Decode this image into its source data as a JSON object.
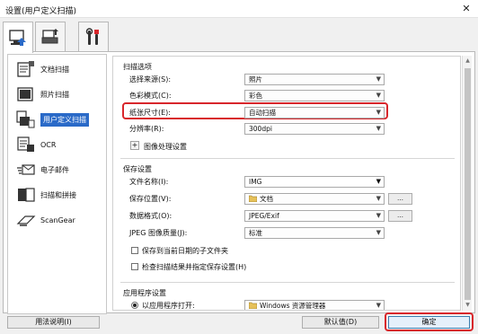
{
  "window": {
    "title": "设置(用户定义扫描)",
    "close": "✕"
  },
  "tabs": [
    {
      "name": "scan-from-computer",
      "icon": "computer-scan-icon"
    },
    {
      "name": "scan-from-panel",
      "icon": "scanner-icon"
    },
    {
      "name": "general-settings",
      "icon": "tools-icon"
    }
  ],
  "sidebar": {
    "items": [
      {
        "label": "文档扫描",
        "icon": "document-scan-icon"
      },
      {
        "label": "照片扫描",
        "icon": "photo-scan-icon"
      },
      {
        "label": "用户定义扫描",
        "icon": "custom-scan-icon"
      },
      {
        "label": "OCR",
        "icon": "ocr-icon"
      },
      {
        "label": "电子邮件",
        "icon": "email-icon"
      },
      {
        "label": "扫描和拼接",
        "icon": "stitch-icon"
      },
      {
        "label": "ScanGear",
        "icon": "scangear-icon"
      }
    ]
  },
  "scan_options": {
    "title": "扫描选项",
    "source_label": "选择来源(S):",
    "source_value": "照片",
    "color_label": "色彩模式(C):",
    "color_value": "彩色",
    "paper_label": "纸张尺寸(E):",
    "paper_value": "自动扫描",
    "resolution_label": "分辨率(R):",
    "resolution_value": "300dpi",
    "image_processing_label": "图像处理设置"
  },
  "save_settings": {
    "title": "保存设置",
    "filename_label": "文件名称(I):",
    "filename_value": "IMG",
    "location_label": "保存位置(V):",
    "location_value": "文档",
    "format_label": "数据格式(O):",
    "format_value": "JPEG/Exif",
    "quality_label": "JPEG 图像质量(J):",
    "quality_value": "标准",
    "subfolder_label": "保存到当前日期的子文件夹",
    "check_results_label": "检查扫描结果并指定保存设置(H)"
  },
  "app_settings": {
    "title": "应用程序设置",
    "open_with_label": "以应用程序打开:",
    "open_with_value": "Windows 资源管理器"
  },
  "buttons": {
    "help": "用法说明(I)",
    "defaults": "默认值(D)",
    "ok": "确定"
  },
  "colors": {
    "accent": "#2a6ac8",
    "highlight": "#d8262b"
  }
}
